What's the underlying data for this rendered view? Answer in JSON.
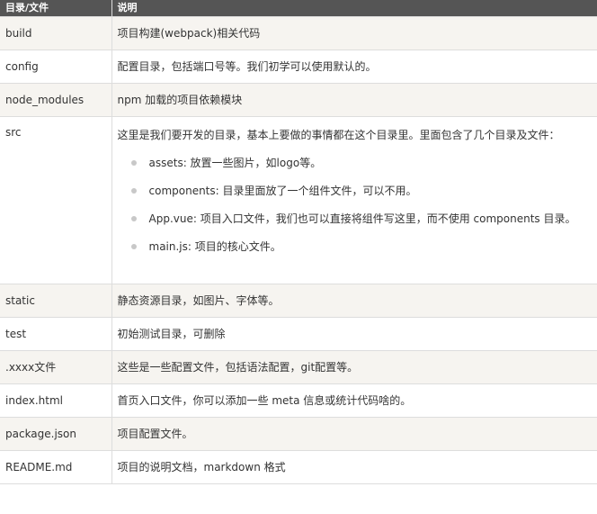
{
  "header": {
    "col1": "目录/文件",
    "col2": "说明"
  },
  "rows": [
    {
      "name": "build",
      "desc": "项目构建(webpack)相关代码"
    },
    {
      "name": "config",
      "desc": "配置目录，包括端口号等。我们初学可以使用默认的。"
    },
    {
      "name": "node_modules",
      "desc": "npm 加载的项目依赖模块"
    },
    {
      "name": "src",
      "desc": "这里是我们要开发的目录，基本上要做的事情都在这个目录里。里面包含了几个目录及文件：",
      "bullets": [
        "assets: 放置一些图片，如logo等。",
        "components: 目录里面放了一个组件文件，可以不用。",
        "App.vue: 项目入口文件，我们也可以直接将组件写这里，而不使用 components 目录。",
        "main.js: 项目的核心文件。"
      ]
    },
    {
      "name": "static",
      "desc": "静态资源目录，如图片、字体等。"
    },
    {
      "name": "test",
      "desc": "初始测试目录，可删除"
    },
    {
      "name": ".xxxx文件",
      "desc": "这些是一些配置文件，包括语法配置，git配置等。"
    },
    {
      "name": "index.html",
      "desc": "首页入口文件，你可以添加一些 meta 信息或统计代码啥的。"
    },
    {
      "name": "package.json",
      "desc": "项目配置文件。"
    },
    {
      "name": "README.md",
      "desc": "项目的说明文档，markdown 格式"
    }
  ]
}
